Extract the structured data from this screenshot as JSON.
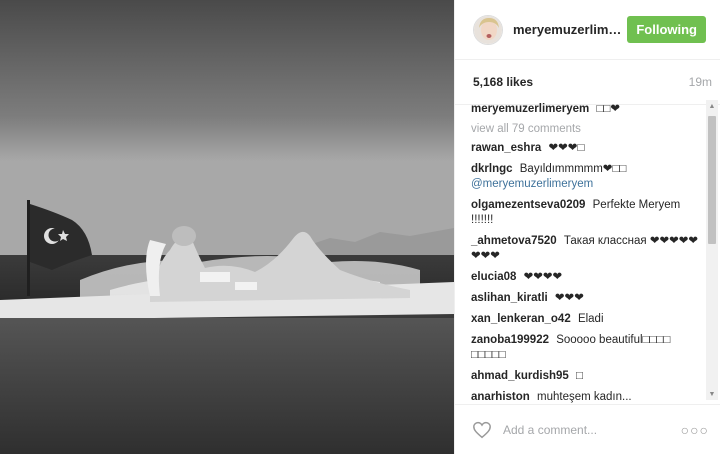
{
  "post": {
    "username": "meryemuzerlimeryem",
    "follow_label": "Following",
    "likes": "5,168 likes",
    "time": "19m",
    "caption": {
      "author": "meryemuzerlimeryem",
      "text": "□□❤"
    },
    "view_all": "view all 79 comments",
    "comments": [
      {
        "author": "rawan_eshra",
        "text": "❤❤❤□",
        "mention": ""
      },
      {
        "author": "dkrlngc",
        "text": "Bayıldımmmmm❤□□",
        "mention": "@meryemuzerlimeryem"
      },
      {
        "author": "olgamezentseva0209",
        "text": "Perfekte Meryem !!!!!!!",
        "mention": ""
      },
      {
        "author": "_ahmetova7520",
        "text": "Такая классная ❤❤❤❤❤❤❤❤",
        "mention": ""
      },
      {
        "author": "elucia08",
        "text": "❤❤❤❤",
        "mention": ""
      },
      {
        "author": "aslihan_kiratli",
        "text": "❤❤❤",
        "mention": ""
      },
      {
        "author": "xan_lenkeran_o42",
        "text": "Eladi",
        "mention": ""
      },
      {
        "author": "zanoba199922",
        "text": "Sooooo beautiful□□□□ □□□□□",
        "mention": ""
      },
      {
        "author": "ahmad_kurdish95",
        "text": "□",
        "mention": ""
      },
      {
        "author": "anarhiston",
        "text": "muhteşem kadın...",
        "mention": ""
      }
    ],
    "add_comment_placeholder": "Add a comment...",
    "more_label": "○○○"
  },
  "icons": {
    "like": "heart-outline-icon",
    "more": "ellipsis-icon"
  },
  "colors": {
    "follow_button": "#70c050",
    "mention": "#3f729b",
    "muted": "#a5a7aa"
  }
}
